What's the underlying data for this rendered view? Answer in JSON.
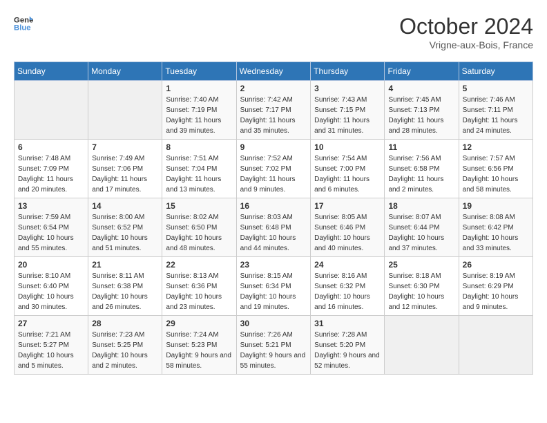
{
  "header": {
    "logo_line1": "General",
    "logo_line2": "Blue",
    "month": "October 2024",
    "location": "Vrigne-aux-Bois, France"
  },
  "days_of_week": [
    "Sunday",
    "Monday",
    "Tuesday",
    "Wednesday",
    "Thursday",
    "Friday",
    "Saturday"
  ],
  "weeks": [
    [
      {
        "num": "",
        "info": ""
      },
      {
        "num": "",
        "info": ""
      },
      {
        "num": "1",
        "info": "Sunrise: 7:40 AM\nSunset: 7:19 PM\nDaylight: 11 hours and 39 minutes."
      },
      {
        "num": "2",
        "info": "Sunrise: 7:42 AM\nSunset: 7:17 PM\nDaylight: 11 hours and 35 minutes."
      },
      {
        "num": "3",
        "info": "Sunrise: 7:43 AM\nSunset: 7:15 PM\nDaylight: 11 hours and 31 minutes."
      },
      {
        "num": "4",
        "info": "Sunrise: 7:45 AM\nSunset: 7:13 PM\nDaylight: 11 hours and 28 minutes."
      },
      {
        "num": "5",
        "info": "Sunrise: 7:46 AM\nSunset: 7:11 PM\nDaylight: 11 hours and 24 minutes."
      }
    ],
    [
      {
        "num": "6",
        "info": "Sunrise: 7:48 AM\nSunset: 7:09 PM\nDaylight: 11 hours and 20 minutes."
      },
      {
        "num": "7",
        "info": "Sunrise: 7:49 AM\nSunset: 7:06 PM\nDaylight: 11 hours and 17 minutes."
      },
      {
        "num": "8",
        "info": "Sunrise: 7:51 AM\nSunset: 7:04 PM\nDaylight: 11 hours and 13 minutes."
      },
      {
        "num": "9",
        "info": "Sunrise: 7:52 AM\nSunset: 7:02 PM\nDaylight: 11 hours and 9 minutes."
      },
      {
        "num": "10",
        "info": "Sunrise: 7:54 AM\nSunset: 7:00 PM\nDaylight: 11 hours and 6 minutes."
      },
      {
        "num": "11",
        "info": "Sunrise: 7:56 AM\nSunset: 6:58 PM\nDaylight: 11 hours and 2 minutes."
      },
      {
        "num": "12",
        "info": "Sunrise: 7:57 AM\nSunset: 6:56 PM\nDaylight: 10 hours and 58 minutes."
      }
    ],
    [
      {
        "num": "13",
        "info": "Sunrise: 7:59 AM\nSunset: 6:54 PM\nDaylight: 10 hours and 55 minutes."
      },
      {
        "num": "14",
        "info": "Sunrise: 8:00 AM\nSunset: 6:52 PM\nDaylight: 10 hours and 51 minutes."
      },
      {
        "num": "15",
        "info": "Sunrise: 8:02 AM\nSunset: 6:50 PM\nDaylight: 10 hours and 48 minutes."
      },
      {
        "num": "16",
        "info": "Sunrise: 8:03 AM\nSunset: 6:48 PM\nDaylight: 10 hours and 44 minutes."
      },
      {
        "num": "17",
        "info": "Sunrise: 8:05 AM\nSunset: 6:46 PM\nDaylight: 10 hours and 40 minutes."
      },
      {
        "num": "18",
        "info": "Sunrise: 8:07 AM\nSunset: 6:44 PM\nDaylight: 10 hours and 37 minutes."
      },
      {
        "num": "19",
        "info": "Sunrise: 8:08 AM\nSunset: 6:42 PM\nDaylight: 10 hours and 33 minutes."
      }
    ],
    [
      {
        "num": "20",
        "info": "Sunrise: 8:10 AM\nSunset: 6:40 PM\nDaylight: 10 hours and 30 minutes."
      },
      {
        "num": "21",
        "info": "Sunrise: 8:11 AM\nSunset: 6:38 PM\nDaylight: 10 hours and 26 minutes."
      },
      {
        "num": "22",
        "info": "Sunrise: 8:13 AM\nSunset: 6:36 PM\nDaylight: 10 hours and 23 minutes."
      },
      {
        "num": "23",
        "info": "Sunrise: 8:15 AM\nSunset: 6:34 PM\nDaylight: 10 hours and 19 minutes."
      },
      {
        "num": "24",
        "info": "Sunrise: 8:16 AM\nSunset: 6:32 PM\nDaylight: 10 hours and 16 minutes."
      },
      {
        "num": "25",
        "info": "Sunrise: 8:18 AM\nSunset: 6:30 PM\nDaylight: 10 hours and 12 minutes."
      },
      {
        "num": "26",
        "info": "Sunrise: 8:19 AM\nSunset: 6:29 PM\nDaylight: 10 hours and 9 minutes."
      }
    ],
    [
      {
        "num": "27",
        "info": "Sunrise: 7:21 AM\nSunset: 5:27 PM\nDaylight: 10 hours and 5 minutes."
      },
      {
        "num": "28",
        "info": "Sunrise: 7:23 AM\nSunset: 5:25 PM\nDaylight: 10 hours and 2 minutes."
      },
      {
        "num": "29",
        "info": "Sunrise: 7:24 AM\nSunset: 5:23 PM\nDaylight: 9 hours and 58 minutes."
      },
      {
        "num": "30",
        "info": "Sunrise: 7:26 AM\nSunset: 5:21 PM\nDaylight: 9 hours and 55 minutes."
      },
      {
        "num": "31",
        "info": "Sunrise: 7:28 AM\nSunset: 5:20 PM\nDaylight: 9 hours and 52 minutes."
      },
      {
        "num": "",
        "info": ""
      },
      {
        "num": "",
        "info": ""
      }
    ]
  ]
}
